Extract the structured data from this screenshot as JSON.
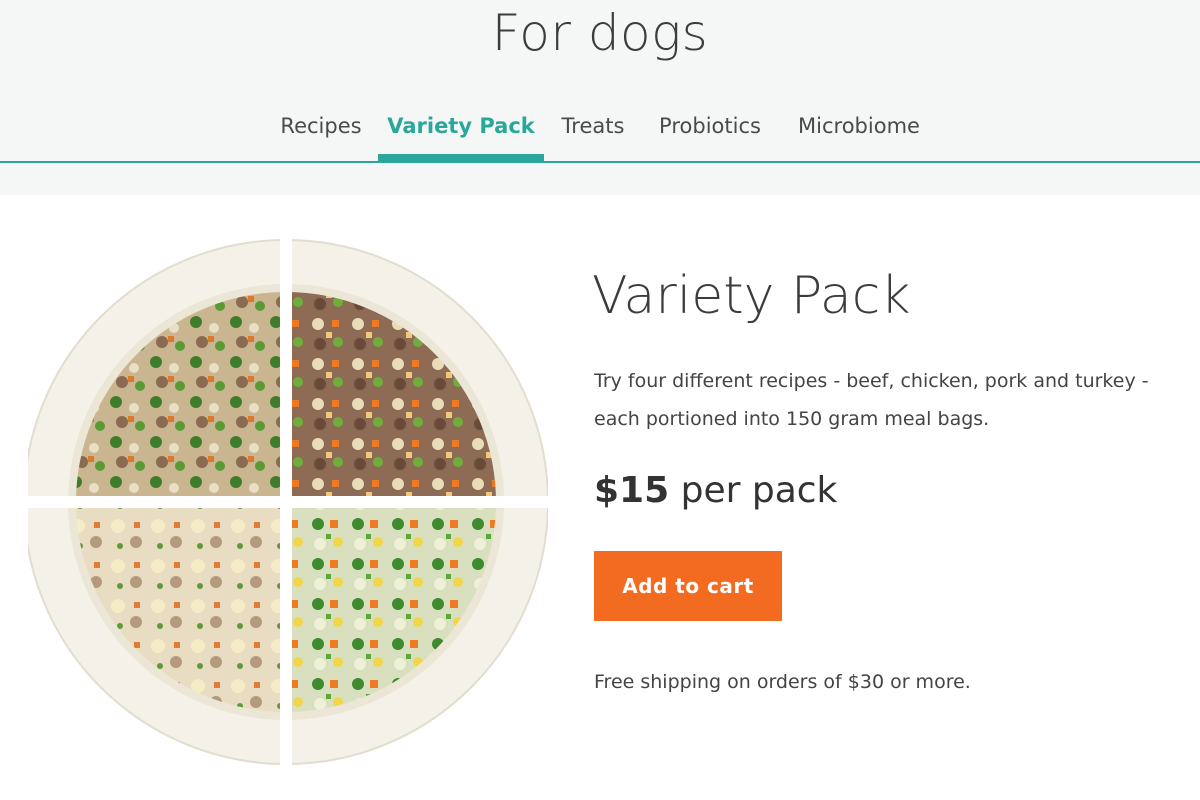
{
  "header": {
    "title": "For dogs",
    "accent_color": "#2aa79a",
    "tabs": [
      {
        "label": "Recipes",
        "active": false
      },
      {
        "label": "Variety Pack",
        "active": true
      },
      {
        "label": "Treats",
        "active": false
      },
      {
        "label": "Probiotics",
        "active": false
      },
      {
        "label": "Microbiome",
        "active": false
      }
    ]
  },
  "product": {
    "name": "Variety Pack",
    "description": "Try four different recipes - beef, chicken, pork and turkey - each portioned into 150 gram meal bags.",
    "price_amount": "$15",
    "price_unit": "per pack",
    "add_to_cart_label": "Add to cart",
    "button_color": "#f26b21",
    "shipping_note": "Free shipping on orders of $30 or more.",
    "image_icon": "food-bowl-quartered"
  }
}
